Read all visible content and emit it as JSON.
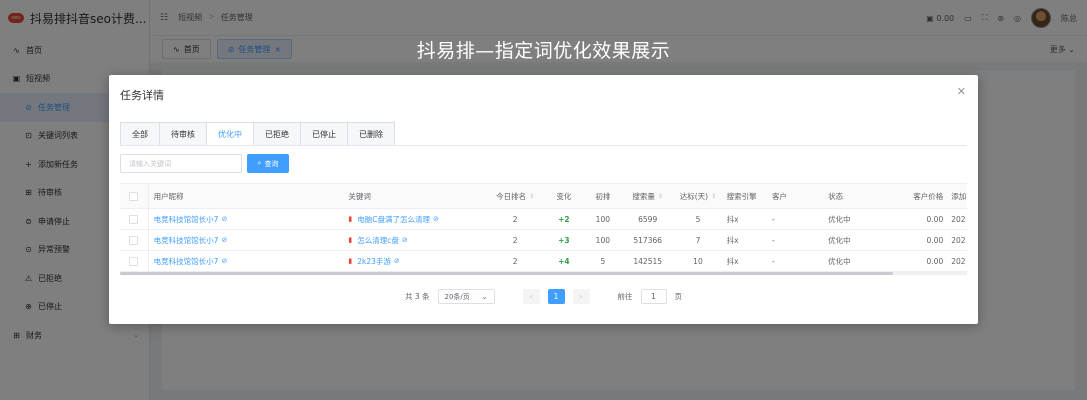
{
  "app": {
    "logo_badge": "seo",
    "title": "抖易排抖音seo计费..."
  },
  "sidebar": {
    "items": [
      {
        "icon": "chart-icon",
        "glyph": "∿",
        "label": "首页"
      },
      {
        "icon": "video-icon",
        "glyph": "▣",
        "label": "短视频"
      },
      {
        "icon": "task-icon",
        "glyph": "⊘",
        "label": "任务管理"
      },
      {
        "icon": "keyword-icon",
        "glyph": "⊡",
        "label": "关键词列表"
      },
      {
        "icon": "plus-icon",
        "glyph": "+",
        "label": "添加新任务"
      },
      {
        "icon": "review-icon",
        "glyph": "⊞",
        "label": "待审核"
      },
      {
        "icon": "stop-request-icon",
        "glyph": "⊜",
        "label": "申请停止"
      },
      {
        "icon": "warning-icon",
        "glyph": "⊙",
        "label": "异常预警"
      },
      {
        "icon": "reject-icon",
        "glyph": "⚠",
        "label": "已拒绝"
      },
      {
        "icon": "stopped-icon",
        "glyph": "⊕",
        "label": "已停止"
      },
      {
        "icon": "finance-icon",
        "glyph": "⊞",
        "label": "财务"
      }
    ]
  },
  "topbar": {
    "breadcrumb": [
      "短视频",
      "任务管理"
    ],
    "balance": "0.00",
    "username": "陈总"
  },
  "tagsbar": {
    "tags": [
      {
        "label": "首页",
        "icon": "∿"
      },
      {
        "label": "任务管理",
        "icon": "⊘"
      }
    ],
    "more": "更多"
  },
  "banner": "抖易排—指定词优化效果展示",
  "dialog": {
    "title": "任务详情",
    "tabs": [
      "全部",
      "待审核",
      "优化中",
      "已拒绝",
      "已停止",
      "已删除"
    ],
    "search_placeholder": "请输入关键词",
    "search_button": "查询",
    "columns": {
      "nick": "用户昵称",
      "keyword": "关键词",
      "rank": "今日排名",
      "change": "变化",
      "initial": "初排",
      "search_volume": "搜索量",
      "days": "达标(天)",
      "engine": "搜索引擎",
      "customer": "客户",
      "status": "状态",
      "price": "客户价格",
      "added": "添加"
    },
    "rows": [
      {
        "nick": "电竞科技馆馆长小7",
        "keyword": "电脑C盘满了怎么清理",
        "rank": "2",
        "change": "+2",
        "initial": "100",
        "search_volume": "6599",
        "days": "5",
        "engine": "抖x",
        "customer": "-",
        "status": "优化中",
        "price": "0.00",
        "added": "202"
      },
      {
        "nick": "电竞科技馆馆长小7",
        "keyword": "怎么清理c盘",
        "rank": "2",
        "change": "+3",
        "initial": "100",
        "search_volume": "517366",
        "days": "7",
        "engine": "抖x",
        "customer": "-",
        "status": "优化中",
        "price": "0.00",
        "added": "202"
      },
      {
        "nick": "电竞科技馆馆长小7",
        "keyword": "2k23手游",
        "rank": "2",
        "change": "+4",
        "initial": "5",
        "search_volume": "142515",
        "days": "10",
        "engine": "抖x",
        "customer": "-",
        "status": "优化中",
        "price": "0.00",
        "added": "202"
      }
    ],
    "pagination": {
      "total": "共 3 条",
      "page_size": "20条/页",
      "current_page": "1",
      "goto_label": "前往",
      "goto_value": "1",
      "page_unit": "页"
    }
  }
}
